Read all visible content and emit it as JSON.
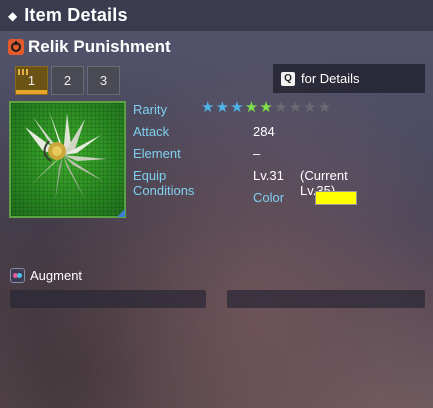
{
  "header": {
    "title": "Item Details"
  },
  "item": {
    "name": "Relik Punishment",
    "category_icon": "relik-category-icon",
    "image_icon": "relik-flower-icon"
  },
  "tabs": [
    {
      "label": "1",
      "active": true
    },
    {
      "label": "2",
      "active": false
    },
    {
      "label": "3",
      "active": false
    }
  ],
  "details_button": {
    "key": "Q",
    "label": "for Details"
  },
  "stats": {
    "rarity_label": "Rarity",
    "rarity": {
      "max": 9,
      "filled": 5,
      "blue_count": 3,
      "green_count": 2
    },
    "attack_label": "Attack",
    "attack_value": "284",
    "element_label": "Element",
    "element_value": "–",
    "equip_label": "Equip Conditions",
    "equip_value": "Lv.31",
    "current_level": "(Current Lv.35)",
    "color_label": "Color",
    "color_value": "#ffff00"
  },
  "augment": {
    "label": "Augment"
  },
  "colors": {
    "stat_label": "#7fd1f0",
    "star_blue": "#4fb3e8",
    "star_green": "#7de04a",
    "star_empty": "#6a6a72",
    "tab_active": "#e8a52a"
  }
}
